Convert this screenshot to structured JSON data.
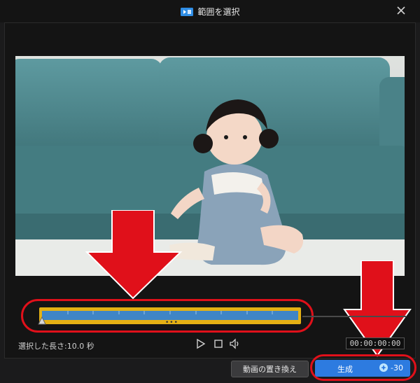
{
  "window": {
    "title": "範囲を選択"
  },
  "timeline": {
    "selected_length": "選択した長さ:10.0 秒",
    "timecode": "00:00:00:00"
  },
  "buttons": {
    "replace_video": "動画の置き換え",
    "generate": "生成",
    "credit_cost": "-30"
  },
  "colors": {
    "accent_blue": "#2d7be0",
    "selection_yellow": "#e4b114",
    "selection_fill": "#3f85c6",
    "annotation_red": "#e0101a"
  },
  "icons": [
    "app-logo-icon",
    "close-icon",
    "play-icon",
    "stop-icon",
    "volume-icon",
    "credit-icon"
  ]
}
